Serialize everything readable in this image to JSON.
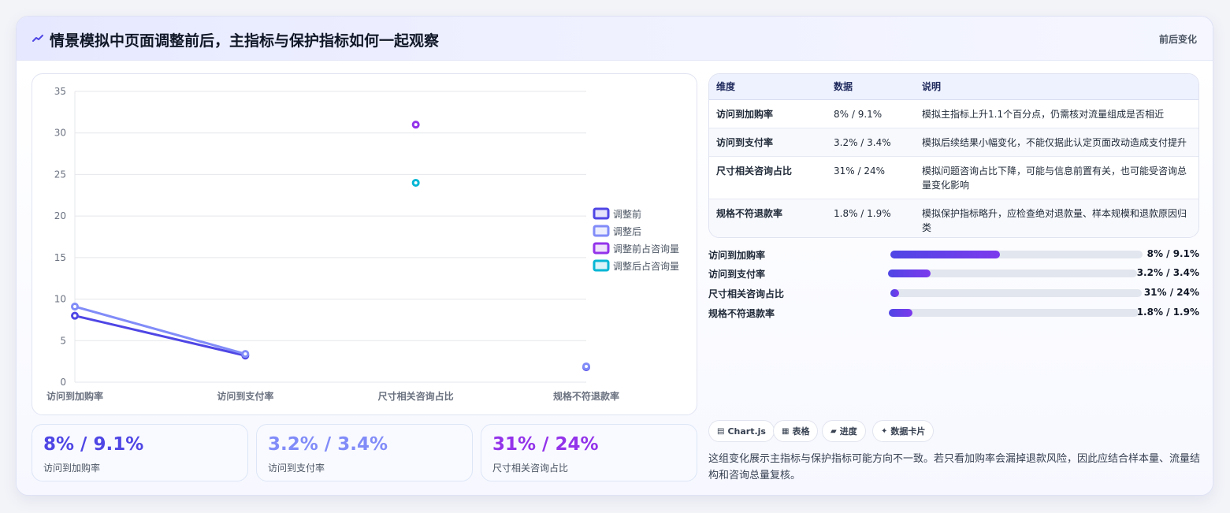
{
  "header": {
    "title": "情景模拟中页面调整前后，主指标与保护指标如何一起观察",
    "tag": "前后变化"
  },
  "chart_data": {
    "type": "line",
    "categories": [
      "访问到加购率",
      "访问到支付率",
      "尺寸相关咨询占比",
      "规格不符退款率"
    ],
    "ylim": [
      0,
      35
    ],
    "yticks": [
      0,
      5,
      10,
      15,
      20,
      25,
      30,
      35
    ],
    "grid": true,
    "legend_position": "right",
    "series": [
      {
        "name": "调整前",
        "values": [
          8,
          3.2,
          null,
          1.8
        ],
        "color": "#4f46e5",
        "kind": "line"
      },
      {
        "name": "调整后",
        "values": [
          9.1,
          3.4,
          null,
          1.9
        ],
        "color": "#818cf8",
        "kind": "line"
      },
      {
        "name": "调整前占咨询量",
        "values": [
          null,
          null,
          31,
          null
        ],
        "color": "#9333ea",
        "kind": "point"
      },
      {
        "name": "调整后占咨询量",
        "values": [
          null,
          null,
          24,
          null
        ],
        "color": "#06b6d4",
        "kind": "point"
      }
    ]
  },
  "stats": [
    {
      "value": "8% / 9.1%",
      "label": "访问到加购率",
      "color": "#4f46e5"
    },
    {
      "value": "3.2% / 3.4%",
      "label": "访问到支付率",
      "color": "#818cf8"
    },
    {
      "value": "31% / 24%",
      "label": "尺寸相关咨询占比",
      "color": "#9333ea"
    }
  ],
  "table": {
    "headers": [
      "维度",
      "数据",
      "说明"
    ],
    "rows": [
      {
        "dim": "访问到加购率",
        "data": "8% / 9.1%",
        "desc": "模拟主指标上升1.1个百分点，仍需核对流量组成是否相近"
      },
      {
        "dim": "访问到支付率",
        "data": "3.2% / 3.4%",
        "desc": "模拟后续结果小幅变化，不能仅据此认定页面改动造成支付提升"
      },
      {
        "dim": "尺寸相关咨询占比",
        "data": "31% / 24%",
        "desc": "模拟问题咨询占比下降，可能与信息前置有关，也可能受咨询总量变化影响"
      },
      {
        "dim": "规格不符退款率",
        "data": "1.8% / 1.9%",
        "desc": "模拟保护指标略升，应检查绝对退款量、样本规模和退款原因归类"
      }
    ]
  },
  "progress": [
    {
      "label": "访问到加购率",
      "value": "8% / 9.1%",
      "fraction": 0.435
    },
    {
      "label": "访问到支付率",
      "value": "3.2% / 3.4%",
      "fraction": 0.17
    },
    {
      "label": "尺寸相关咨询占比",
      "value": "31% / 24%",
      "fraction": 0.03
    },
    {
      "label": "规格不符退款率",
      "value": "1.8% / 1.9%",
      "fraction": 0.095
    }
  ],
  "chips": [
    {
      "icon": "▤",
      "label": "Chart.js"
    },
    {
      "icon": "▦",
      "label": "表格"
    },
    {
      "icon": "▰",
      "label": "进度"
    },
    {
      "icon": "✦",
      "label": "数据卡片"
    }
  ],
  "note": "这组变化展示主指标与保护指标可能方向不一致。若只看加购率会漏掉退款风险，因此应结合样本量、流量结构和咨询总量复核。"
}
